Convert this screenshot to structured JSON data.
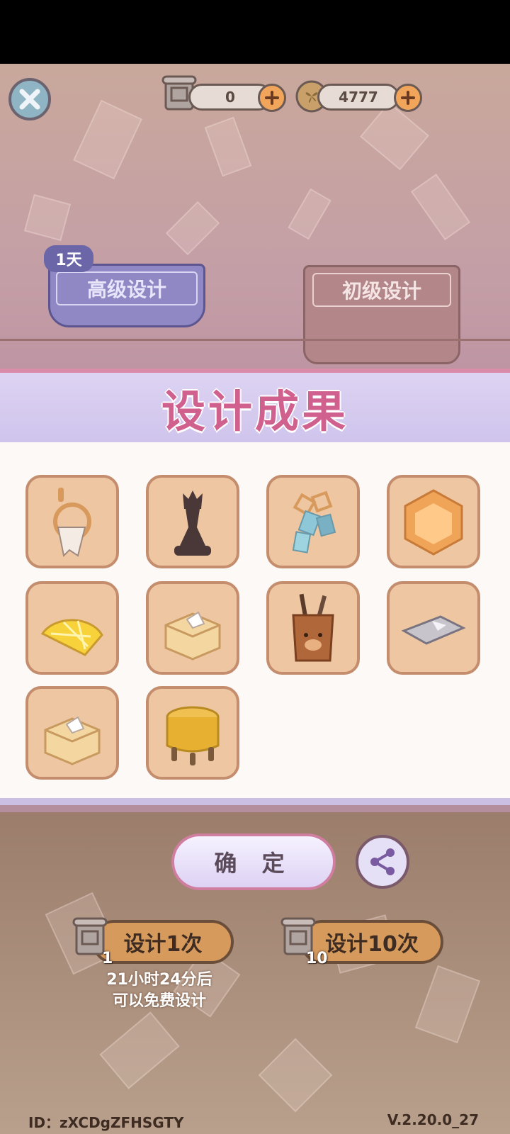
{
  "resources": {
    "scrolls": {
      "value": "0",
      "icon": "scroll-icon"
    },
    "coins": {
      "value": "4777",
      "icon": "clover-coin-icon"
    }
  },
  "tabs": {
    "advanced": {
      "label": "高级设计",
      "badge": "1天"
    },
    "basic": {
      "label": "初级设计"
    }
  },
  "result": {
    "title": "设计成果",
    "items": [
      {
        "name": "towel-ring-icon"
      },
      {
        "name": "chess-queen-icon"
      },
      {
        "name": "chain-lamp-icon"
      },
      {
        "name": "corner-sofa-icon"
      },
      {
        "name": "lemon-slice-icon"
      },
      {
        "name": "tissue-box-icon"
      },
      {
        "name": "bear-pen-holder-icon"
      },
      {
        "name": "mat-icon"
      },
      {
        "name": "tissue-box-icon"
      },
      {
        "name": "stool-icon"
      }
    ]
  },
  "actions": {
    "confirm_label": "确 定",
    "design_once_label": "设计1次",
    "design_once_cost": "1",
    "design_ten_label": "设计10次",
    "design_ten_cost": "10",
    "free_hint_line1": "21小时24分后",
    "free_hint_line2": "可以免费设计"
  },
  "footer": {
    "id": "ID：zXCDgZFHSGTY",
    "version": "V.2.20.0_27"
  },
  "colors": {
    "accent_pink": "#d0608e",
    "card_bg": "#eec7a2",
    "button_brown": "#d69a5c"
  }
}
